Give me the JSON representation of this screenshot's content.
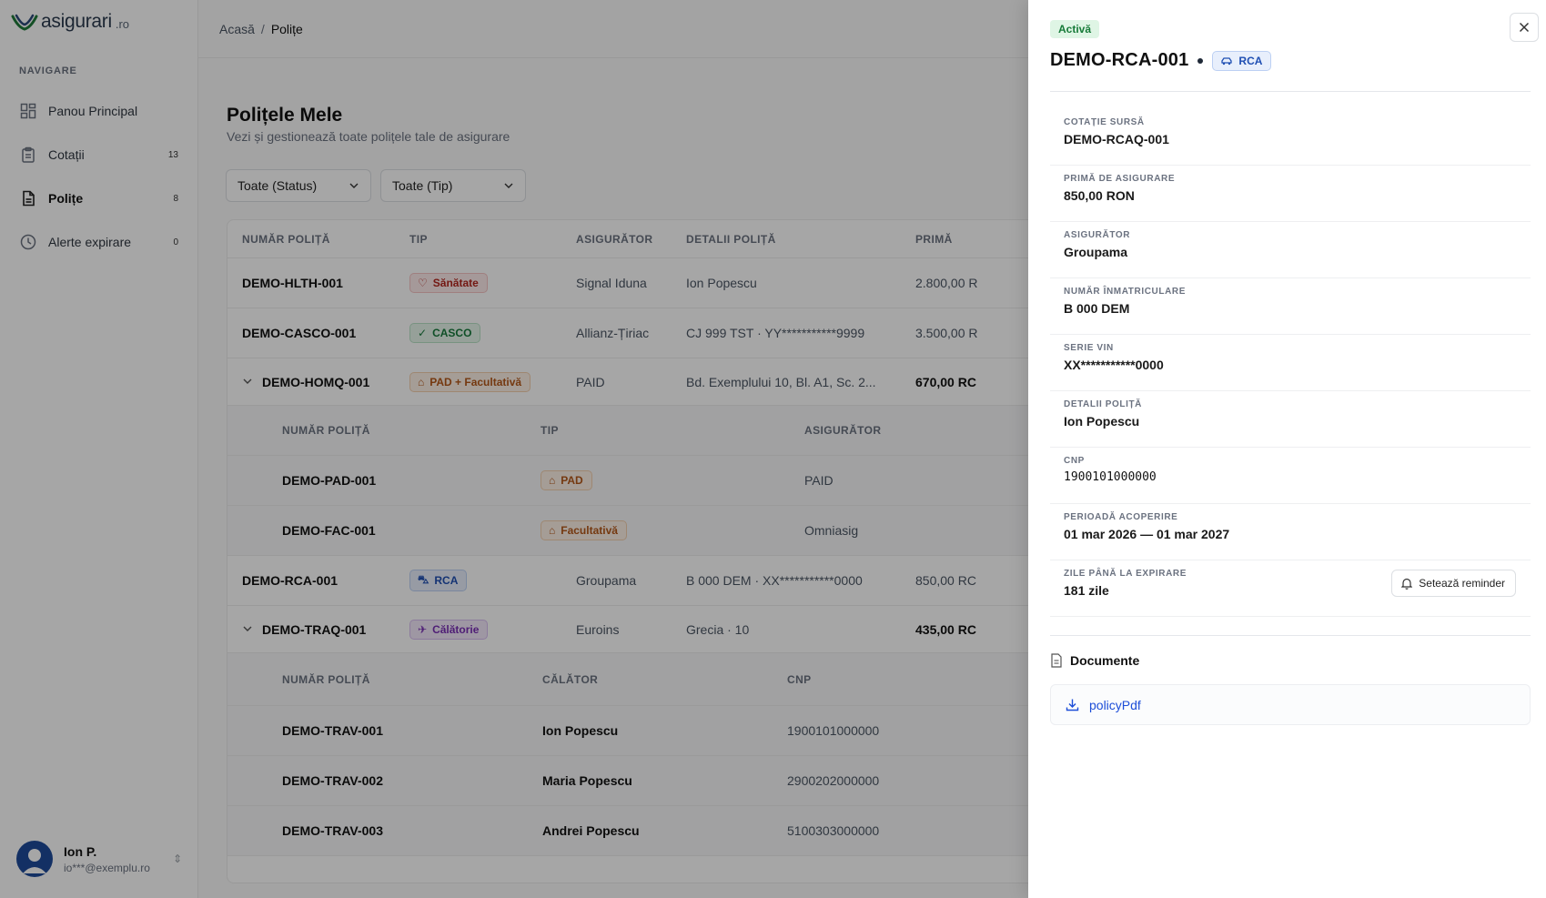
{
  "brand": {
    "name": "asigurari",
    "tld": ".ro"
  },
  "sidebar": {
    "heading": "NAVIGARE",
    "items": [
      {
        "label": "Panou Principal",
        "badge": ""
      },
      {
        "label": "Cotații",
        "badge": "13"
      },
      {
        "label": "Polițe",
        "badge": "8"
      },
      {
        "label": "Alerte expirare",
        "badge": "0"
      }
    ],
    "user": {
      "name": "Ion P.",
      "email": "io***@exemplu.ro"
    }
  },
  "breadcrumb": {
    "home": "Acasă",
    "separator": "/",
    "current": "Polițe"
  },
  "page": {
    "title": "Polițele Mele",
    "subtitle": "Vezi și gestionează toate polițele tale de asigurare",
    "filters": {
      "status": "Toate (Status)",
      "type": "Toate (Tip)"
    }
  },
  "table": {
    "headers": [
      "NUMĂR POLIȚĂ",
      "TIP",
      "ASIGURĂTOR",
      "DETALII POLIȚĂ",
      "PRIMĂ"
    ],
    "rows": [
      {
        "number": "DEMO-HLTH-001",
        "type": "Sănătate",
        "insurer": "Signal Iduna",
        "details": "Ion Popescu",
        "premium": "2.800,00 R"
      },
      {
        "number": "DEMO-CASCO-001",
        "type": "CASCO",
        "insurer": "Allianz-Țiriac",
        "details": "CJ 999 TST · YY***********9999",
        "premium": "3.500,00 R"
      },
      {
        "number": "DEMO-HOMQ-001",
        "type": "PAD + Facultativă",
        "insurer": "PAID",
        "details": "Bd. Exemplului 10, Bl. A1, Sc. 2...",
        "premium": "670,00 RC"
      },
      {
        "number": "DEMO-RCA-001",
        "type": "RCA",
        "insurer": "Groupama",
        "details": "B 000 DEM · XX***********0000",
        "premium": "850,00 RC"
      },
      {
        "number": "DEMO-TRAQ-001",
        "type": "Călătorie",
        "insurer": "Euroins",
        "details": "Grecia · 10",
        "premium": "435,00 RC"
      }
    ],
    "home_sub": {
      "headers": [
        "NUMĂR POLIȚĂ",
        "TIP",
        "ASIGURĂTOR"
      ],
      "rows": [
        {
          "number": "DEMO-PAD-001",
          "type": "PAD",
          "insurer": "PAID"
        },
        {
          "number": "DEMO-FAC-001",
          "type": "Facultativă",
          "insurer": "Omniasig"
        }
      ]
    },
    "travel_sub": {
      "headers": [
        "NUMĂR POLIȚĂ",
        "CĂLĂTOR",
        "CNP"
      ],
      "rows": [
        {
          "number": "DEMO-TRAV-001",
          "traveler": "Ion Popescu",
          "cnp": "1900101000000"
        },
        {
          "number": "DEMO-TRAV-002",
          "traveler": "Maria Popescu",
          "cnp": "2900202000000"
        },
        {
          "number": "DEMO-TRAV-003",
          "traveler": "Andrei Popescu",
          "cnp": "5100303000000"
        }
      ]
    }
  },
  "drawer": {
    "status": "Activă",
    "policy_number": "DEMO-RCA-001",
    "type": "RCA",
    "fields": [
      {
        "label": "COTAȚIE SURSĂ",
        "value": "DEMO-RCAQ-001"
      },
      {
        "label": "PRIMĂ DE ASIGURARE",
        "value": "850,00 RON"
      },
      {
        "label": "ASIGURĂTOR",
        "value": "Groupama"
      },
      {
        "label": "NUMĂR ÎNMATRICULARE",
        "value": "B 000 DEM"
      },
      {
        "label": "SERIE VIN",
        "value": "XX***********0000"
      },
      {
        "label": "DETALII POLIȚĂ",
        "value": "Ion Popescu"
      },
      {
        "label": "CNP",
        "value": "1900101000000"
      },
      {
        "label": "PERIOADĂ ACOPERIRE",
        "value": "01 mar 2026 — 01 mar 2027"
      },
      {
        "label": "ZILE PÂNĂ LA EXPIRARE",
        "value": "181 zile"
      }
    ],
    "reminder_label": "Setează reminder",
    "documents_title": "Documente",
    "documents": [
      "policyPdf"
    ]
  },
  "colors": {
    "accent_blue": "#1d4ed8",
    "active_green": "#167a38",
    "health_red": "#b3261e",
    "casco_green": "#187a3c",
    "home_orange": "#b4581a",
    "travel_purple": "#7a2fb5"
  }
}
